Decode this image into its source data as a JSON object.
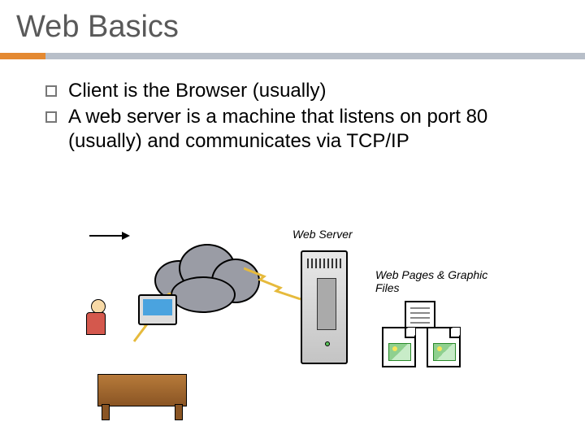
{
  "title": "Web Basics",
  "bullets": [
    "Client is the Browser (usually)",
    "A web server is a machine that listens on port 80 (usually) and communicates via TCP/IP"
  ],
  "diagram": {
    "server_label": "Web Server",
    "files_label": "Web Pages & Graphic Files"
  }
}
